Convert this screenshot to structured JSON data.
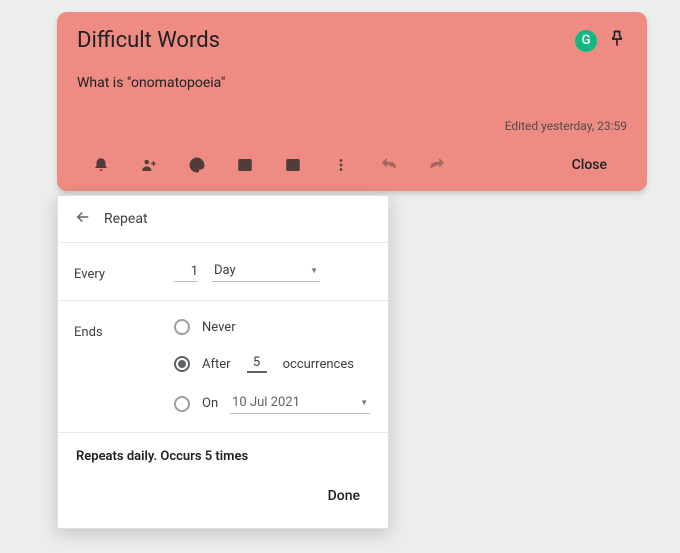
{
  "note": {
    "title": "Difficult Words",
    "body": "What is \"onomatopoeia\"",
    "edited": "Edited yesterday, 23:59",
    "close_label": "Close",
    "g_badge": "G"
  },
  "popup": {
    "title": "Repeat",
    "every_label": "Every",
    "every_value": "1",
    "every_unit": "Day",
    "ends_label": "Ends",
    "ends": {
      "never": "Never",
      "after_prefix": "After",
      "after_count": "5",
      "after_suffix": "occurrences",
      "on_prefix": "On",
      "on_date": "10 Jul 2021",
      "selected": "after"
    },
    "summary": "Repeats daily. Occurs 5 times",
    "done_label": "Done"
  }
}
